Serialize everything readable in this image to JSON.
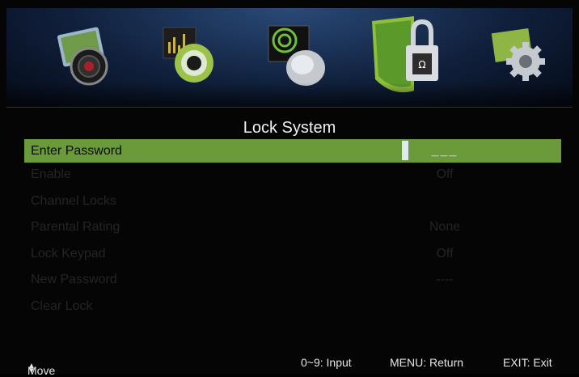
{
  "menu": {
    "icons": [
      {
        "name": "picture-icon"
      },
      {
        "name": "audio-icon"
      },
      {
        "name": "channel-icon"
      },
      {
        "name": "lock-icon",
        "selected": true
      },
      {
        "name": "setup-icon"
      }
    ]
  },
  "title": "Lock System",
  "rows": [
    {
      "label": "Enter Password",
      "value": "___",
      "active": true
    },
    {
      "label": "Enable",
      "value": "Off"
    },
    {
      "label": "Channel Locks",
      "value": ""
    },
    {
      "label": "Parental Rating",
      "value": "None"
    },
    {
      "label": "Lock Keypad",
      "value": "Off"
    },
    {
      "label": "New Password",
      "value": "----"
    },
    {
      "label": "Clear Lock",
      "value": ""
    }
  ],
  "footer": {
    "move": "Move",
    "input": "0~9: Input",
    "menu": "MENU: Return",
    "exit": "EXIT: Exit"
  },
  "colors": {
    "highlight": "#6a9a3a",
    "dim_text": "#242424",
    "icon_bar": "#1a3358"
  }
}
